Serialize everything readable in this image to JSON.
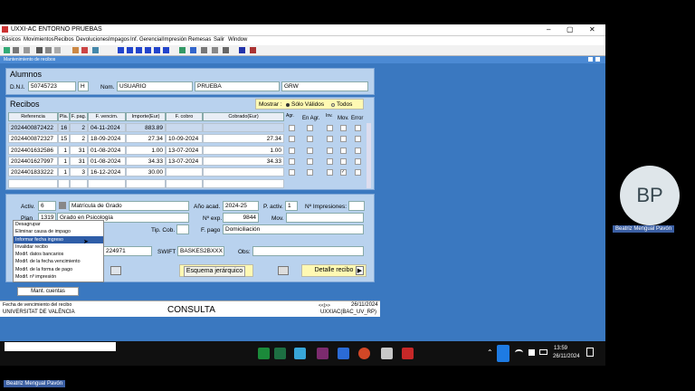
{
  "window": {
    "title": "UXXI-AC ENTORNO PRUEBAS",
    "min": "–",
    "max": "▢",
    "close": "✕"
  },
  "menu": [
    "Básicos",
    "Movimientos",
    "Recibos",
    "Devoluciones",
    "Impagos",
    "Inf. Gerencial",
    "Impresión",
    "Remesas",
    "Salir",
    "Window"
  ],
  "subtitle": "Mantenimiento de recibos",
  "alumnos": {
    "header": "Alumnos",
    "dni_label": "D.N.I.",
    "dni": "50745723",
    "dni_letter": "H",
    "nom_label": "Nom.",
    "nombre": "USUARIO",
    "apellido1": "PRUEBA",
    "apellido2": "GRW"
  },
  "recibos": {
    "header": "Recibos",
    "mostrar_label": "Mostrar :",
    "opt1": "Sólo Válidos",
    "opt2": "Todos",
    "columns": [
      "Referencia",
      "Pla.",
      "F. pag.",
      "F. vencim.",
      "Importe(Eur)",
      "F. cobro",
      "Cobrado(Eur)",
      "Agr.",
      "En Agr.",
      "Inv.",
      "Mov.",
      "Error"
    ],
    "rows": [
      {
        "ref": "2024400872422",
        "pla": "16",
        "fpag": "2",
        "venc": "04-11-2024",
        "imp": "883.89",
        "cobro": "",
        "cobrado": ""
      },
      {
        "ref": "2024400872327",
        "pla": "15",
        "fpag": "2",
        "venc": "18-09-2024",
        "imp": "27.34",
        "cobro": "10-09-2024",
        "cobrado": "27.34"
      },
      {
        "ref": "2024401632586",
        "pla": "1",
        "fpag": "31",
        "venc": "01-08-2024",
        "imp": "1.00",
        "cobro": "13-07-2024",
        "cobrado": "1.00"
      },
      {
        "ref": "2024401627997",
        "pla": "1",
        "fpag": "31",
        "venc": "01-08-2024",
        "imp": "34.33",
        "cobro": "13-07-2024",
        "cobrado": "34.33"
      },
      {
        "ref": "2024401833222",
        "pla": "1",
        "fpag": "3",
        "venc": "16-12-2024",
        "imp": "30.00",
        "cobro": "",
        "cobrado": ""
      }
    ]
  },
  "detalle": {
    "activ_label": "Activ.",
    "activ": "6",
    "activ_desc": "Matrícula de Grado",
    "plan_label": "Plan",
    "plan": "1319",
    "plan_desc": "Grado en Psicología",
    "anyo_label": "Año acad.",
    "anyo": "2024-25",
    "pactiv_label": "P. activ.",
    "pactiv": "1",
    "nimp_label": "Nº Impresiones:",
    "nexp_label": "Nº exp.",
    "nexp": "9844",
    "mov_label": "Mov.",
    "tipcob_label": "Tip. Cob.",
    "fpago_label": "F. pago",
    "fpago": "Domiciliación",
    "cuenta": "224971",
    "swift_label": "SWIFT",
    "swift": "BASKES2BXXX",
    "obs_label": "Obs:"
  },
  "context_menu": [
    "Desagrupar",
    "Eliminar causa de impago",
    "Informar fecha ingreso",
    "Invalidar recibo",
    "Modif. datos bancarios",
    "Modif. de la fecha vencimiento",
    "Modif. de la forma de pago",
    "Modif. nº impresión"
  ],
  "buttons": {
    "mant": "Mant. cuentas",
    "esquema": "Esquema jerárquico",
    "detalle": "Detalle recibo"
  },
  "status": {
    "hint": "Fecha de vencimiento del recibo",
    "org": "UNIVERSITAT DE VALÈNCIA",
    "mode": "CONSULTA",
    "date": "26/11/2024",
    "db": "UXXIAC(BAC_UV_RP)",
    "arrows": "<<|>>"
  },
  "taskbar": {
    "time": "13:59",
    "date": "26/11/2024"
  },
  "participant": {
    "initials": "BP",
    "name": "Beatriz Mengual Pavón"
  },
  "colors": {
    "window": "#3a78c0",
    "panel": "#b9d2ee",
    "highlight": "#2f5ea8"
  }
}
